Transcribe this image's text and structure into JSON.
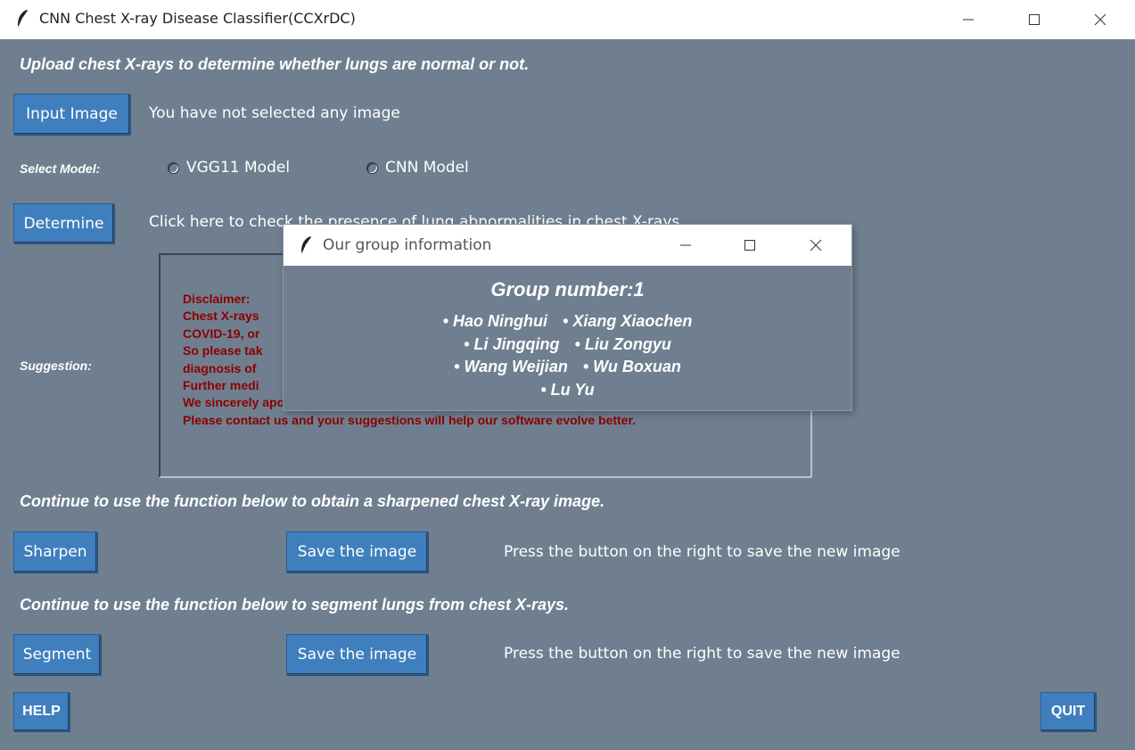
{
  "window": {
    "title": "CNN Chest X-ray Disease Classifier(CCXrDC)",
    "icon": "feather-icon"
  },
  "main": {
    "upload_heading": "Upload chest X-rays to determine whether lungs are normal or not.",
    "input_image_button": "Input Image",
    "image_status": "You have not selected any image",
    "select_model_label": "Select Model:",
    "model_options": [
      "VGG11 Model",
      "CNN Model"
    ],
    "determine_button": "Determine",
    "determine_hint": "Click here to check the presence of lung abnormalities in chest X-rays.",
    "suggestion_label": "Suggestion:",
    "suggestion_lines": [
      "Disclaimer:",
      "Chest X-rays",
      "COVID-19, or",
      "So please tak",
      "diagnosis of",
      "Further medi",
      "We sincerely apologize for potential confusions caused by our misdiagnosis.",
      "Please contact us and your suggestions will help our software evolve better."
    ],
    "sharpen_heading": "Continue to use the function below to obtain a sharpened chest X-ray image.",
    "sharpen_button": "Sharpen",
    "save_image_button_1": "Save the image",
    "save_hint_1": "Press the button on the right to save the new image",
    "segment_heading": "Continue to use the function below to segment lungs from chest X-rays.",
    "segment_button": "Segment",
    "save_image_button_2": "Save the image",
    "save_hint_2": "Press the button on the right to save the new image",
    "help_button": "HELP",
    "quit_button": "QUIT"
  },
  "dialog": {
    "title": "Our group information",
    "heading": "Group number:1",
    "members": [
      "Hao Ninghui",
      "Xiang Xiaochen",
      "Li Jingqing",
      "Liu Zongyu",
      "Wang Weijian",
      "Wu Boxuan",
      "Lu Yu"
    ],
    "bullet": "•"
  },
  "colors": {
    "background": "#6f7f8f",
    "button": "#3f7fbd",
    "disclaimer_text": "#8b0000"
  }
}
